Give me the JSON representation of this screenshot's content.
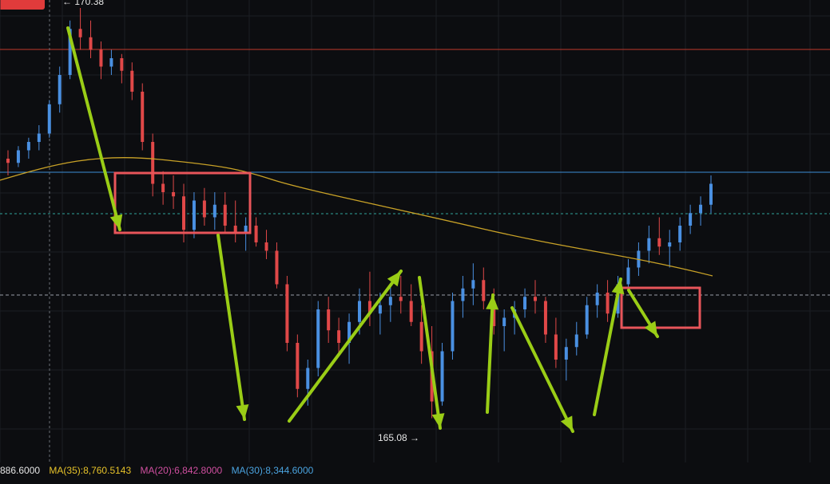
{
  "chart_data": {
    "type": "candlestick",
    "high_marker": "← 170.38",
    "low_marker": "165.08 →",
    "y_high": 170.38,
    "y_low": 165.08,
    "ma_long_color": "#c9a227",
    "up_color": "#4a90e2",
    "down_color": "#e04848",
    "annotation_color": "#9acd16",
    "box_color": "#e8555a",
    "moving_averages": [
      {
        "label": "886.6000",
        "color": "#e6e6e6"
      },
      {
        "label": "MA(35):8,760.5143",
        "color": "#e6c229"
      },
      {
        "label": "MA(20):6,842.8000",
        "color": "#d04fa0"
      },
      {
        "label": "MA(30):8,344.6000",
        "color": "#4aa3df"
      }
    ],
    "candles": [
      [
        0.64,
        0.66,
        0.6,
        0.63
      ],
      [
        0.63,
        0.67,
        0.62,
        0.66
      ],
      [
        0.66,
        0.69,
        0.64,
        0.68
      ],
      [
        0.68,
        0.72,
        0.66,
        0.7
      ],
      [
        0.7,
        0.78,
        0.69,
        0.77
      ],
      [
        0.77,
        0.86,
        0.75,
        0.84
      ],
      [
        0.84,
        0.97,
        0.83,
        0.95
      ],
      [
        0.95,
        1.0,
        0.9,
        0.93
      ],
      [
        0.93,
        0.97,
        0.88,
        0.9
      ],
      [
        0.9,
        0.92,
        0.83,
        0.86
      ],
      [
        0.86,
        0.9,
        0.84,
        0.88
      ],
      [
        0.88,
        0.89,
        0.82,
        0.85
      ],
      [
        0.85,
        0.87,
        0.78,
        0.8
      ],
      [
        0.8,
        0.82,
        0.66,
        0.68
      ],
      [
        0.68,
        0.7,
        0.55,
        0.58
      ],
      [
        0.58,
        0.61,
        0.53,
        0.56
      ],
      [
        0.56,
        0.6,
        0.52,
        0.55
      ],
      [
        0.55,
        0.58,
        0.44,
        0.47
      ],
      [
        0.47,
        0.56,
        0.45,
        0.54
      ],
      [
        0.54,
        0.57,
        0.48,
        0.5
      ],
      [
        0.5,
        0.56,
        0.47,
        0.53
      ],
      [
        0.53,
        0.56,
        0.46,
        0.48
      ],
      [
        0.48,
        0.54,
        0.44,
        0.46
      ],
      [
        0.46,
        0.5,
        0.42,
        0.48
      ],
      [
        0.48,
        0.5,
        0.43,
        0.44
      ],
      [
        0.44,
        0.47,
        0.4,
        0.42
      ],
      [
        0.42,
        0.44,
        0.33,
        0.34
      ],
      [
        0.34,
        0.36,
        0.18,
        0.2
      ],
      [
        0.2,
        0.22,
        0.07,
        0.09
      ],
      [
        0.09,
        0.16,
        0.05,
        0.14
      ],
      [
        0.14,
        0.3,
        0.12,
        0.28
      ],
      [
        0.28,
        0.31,
        0.2,
        0.23
      ],
      [
        0.23,
        0.26,
        0.17,
        0.2
      ],
      [
        0.2,
        0.27,
        0.15,
        0.25
      ],
      [
        0.25,
        0.33,
        0.22,
        0.3
      ],
      [
        0.3,
        0.37,
        0.24,
        0.27
      ],
      [
        0.27,
        0.32,
        0.22,
        0.29
      ],
      [
        0.29,
        0.34,
        0.25,
        0.31
      ],
      [
        0.31,
        0.36,
        0.27,
        0.3
      ],
      [
        0.3,
        0.34,
        0.24,
        0.25
      ],
      [
        0.25,
        0.29,
        0.15,
        0.18
      ],
      [
        0.18,
        0.24,
        0.02,
        0.06
      ],
      [
        0.06,
        0.2,
        0.05,
        0.18
      ],
      [
        0.18,
        0.32,
        0.16,
        0.3
      ],
      [
        0.3,
        0.36,
        0.26,
        0.33
      ],
      [
        0.33,
        0.39,
        0.29,
        0.35
      ],
      [
        0.35,
        0.38,
        0.28,
        0.3
      ],
      [
        0.3,
        0.33,
        0.22,
        0.24
      ],
      [
        0.24,
        0.28,
        0.18,
        0.26
      ],
      [
        0.26,
        0.3,
        0.22,
        0.28
      ],
      [
        0.28,
        0.33,
        0.26,
        0.31
      ],
      [
        0.31,
        0.35,
        0.27,
        0.3
      ],
      [
        0.3,
        0.31,
        0.2,
        0.22
      ],
      [
        0.22,
        0.26,
        0.14,
        0.16
      ],
      [
        0.16,
        0.21,
        0.11,
        0.19
      ],
      [
        0.19,
        0.25,
        0.17,
        0.22
      ],
      [
        0.22,
        0.31,
        0.21,
        0.29
      ],
      [
        0.29,
        0.34,
        0.26,
        0.32
      ],
      [
        0.32,
        0.35,
        0.25,
        0.27
      ],
      [
        0.27,
        0.36,
        0.26,
        0.34
      ],
      [
        0.34,
        0.4,
        0.32,
        0.38
      ],
      [
        0.38,
        0.44,
        0.36,
        0.42
      ],
      [
        0.42,
        0.48,
        0.39,
        0.45
      ],
      [
        0.45,
        0.5,
        0.41,
        0.43
      ],
      [
        0.43,
        0.47,
        0.38,
        0.44
      ],
      [
        0.44,
        0.5,
        0.42,
        0.48
      ],
      [
        0.48,
        0.53,
        0.46,
        0.51
      ],
      [
        0.51,
        0.55,
        0.48,
        0.53
      ],
      [
        0.53,
        0.6,
        0.51,
        0.58
      ]
    ]
  }
}
